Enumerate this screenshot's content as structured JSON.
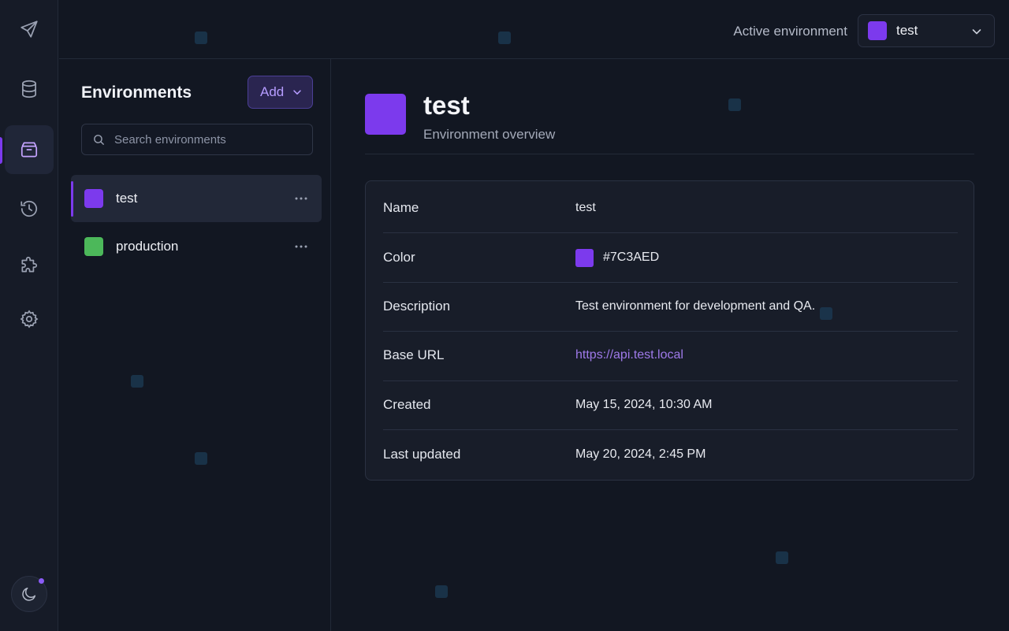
{
  "topbar": {
    "active_env_label": "Active environment",
    "selected_env": {
      "name": "test",
      "color": "#7C3AED"
    }
  },
  "rail": {
    "items": [
      {
        "icon": "send-icon"
      },
      {
        "icon": "database-icon"
      },
      {
        "icon": "environments-icon",
        "active": true
      },
      {
        "icon": "history-icon"
      },
      {
        "icon": "puzzle-icon"
      },
      {
        "icon": "settings-icon"
      }
    ],
    "theme_icon": "moon-icon"
  },
  "sidebar": {
    "title": "Environments",
    "add_label": "Add",
    "search_placeholder": "Search environments",
    "items": [
      {
        "name": "test",
        "color": "#7C3AED",
        "selected": true
      },
      {
        "name": "production",
        "color": "#4CB85A",
        "selected": false
      }
    ]
  },
  "main": {
    "title": "test",
    "subtitle": "Environment overview",
    "swatch_color": "#7C3AED",
    "details": [
      {
        "key": "Name",
        "value": "test"
      },
      {
        "key": "Color",
        "value": "#7C3AED"
      },
      {
        "key": "Description",
        "value": "Test environment for development and QA."
      },
      {
        "key": "Base URL",
        "value": "https://api.test.local"
      },
      {
        "key": "Created",
        "value": "May 15, 2024, 10:30 AM"
      },
      {
        "key": "Last updated",
        "value": "May 20, 2024, 2:45 PM"
      }
    ]
  },
  "colors": {
    "accent": "#7C3AED",
    "production": "#4CB85A",
    "background": "#121722"
  }
}
